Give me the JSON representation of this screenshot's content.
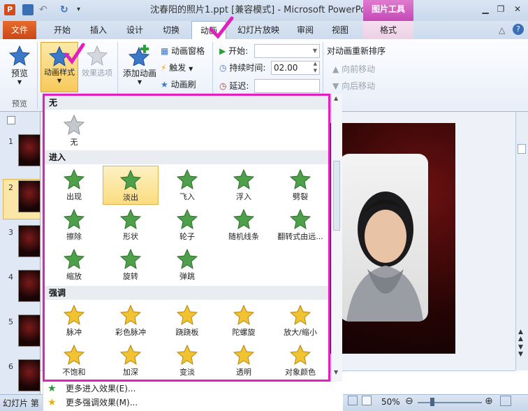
{
  "window": {
    "title": "沈春阳的照片1.ppt [兼容模式] - Microsoft PowerPoint",
    "context_tab_group": "图片工具",
    "app_icon": "P"
  },
  "tabs": [
    "文件",
    "开始",
    "插入",
    "设计",
    "切换",
    "动画",
    "幻灯片放映",
    "审阅",
    "视图",
    "格式"
  ],
  "active_tab": "动画",
  "ribbon": {
    "preview": {
      "label": "预览",
      "group": "预览"
    },
    "anim_styles": {
      "label": "动画样式"
    },
    "effect_options": {
      "label": "效果选项"
    },
    "add_animation": {
      "label": "添加动画"
    },
    "anim_pane": "动画窗格",
    "trigger": "触发",
    "anim_painter": "动画刷",
    "start_label": "开始:",
    "start_value": "",
    "duration_label": "持续时间:",
    "duration_value": "02.00",
    "delay_label": "延迟:",
    "delay_value": "",
    "reorder_title": "对动画重新排序",
    "move_earlier": "向前移动",
    "move_later": "向后移动"
  },
  "gallery": {
    "sections": [
      {
        "title": "无",
        "items": [
          {
            "label": "无",
            "icon": "star-gray-icon"
          }
        ]
      },
      {
        "title": "进入",
        "items": [
          {
            "label": "出现",
            "icon": "star-green-icon"
          },
          {
            "label": "淡出",
            "icon": "star-green-icon",
            "selected": true
          },
          {
            "label": "飞入",
            "icon": "star-green-icon"
          },
          {
            "label": "浮入",
            "icon": "star-green-icon"
          },
          {
            "label": "劈裂",
            "icon": "star-green-icon"
          },
          {
            "label": "擦除",
            "icon": "star-green-icon"
          },
          {
            "label": "形状",
            "icon": "star-green-icon"
          },
          {
            "label": "轮子",
            "icon": "star-green-icon"
          },
          {
            "label": "随机线条",
            "icon": "star-green-icon"
          },
          {
            "label": "翻转式由远...",
            "icon": "star-green-icon"
          },
          {
            "label": "缩放",
            "icon": "star-green-icon"
          },
          {
            "label": "旋转",
            "icon": "star-green-icon"
          },
          {
            "label": "弹跳",
            "icon": "star-green-icon"
          }
        ]
      },
      {
        "title": "强调",
        "items": [
          {
            "label": "脉冲",
            "icon": "star-gold-icon"
          },
          {
            "label": "彩色脉冲",
            "icon": "star-gold-icon"
          },
          {
            "label": "跷跷板",
            "icon": "star-gold-icon"
          },
          {
            "label": "陀螺旋",
            "icon": "star-gold-icon"
          },
          {
            "label": "放大/缩小",
            "icon": "star-gold-icon"
          },
          {
            "label": "不饱和",
            "icon": "star-gold-icon"
          },
          {
            "label": "加深",
            "icon": "star-gold-icon"
          },
          {
            "label": "变淡",
            "icon": "star-gold-icon"
          },
          {
            "label": "透明",
            "icon": "star-gold-icon"
          },
          {
            "label": "对象颜色",
            "icon": "star-gold-icon"
          }
        ]
      }
    ],
    "more": [
      "更多进入效果(E)...",
      "更多强调效果(M)..."
    ]
  },
  "slides": [
    "1",
    "2",
    "3",
    "4",
    "5",
    "6"
  ],
  "status": {
    "slide_label": "幻灯片 第",
    "zoom": "50%"
  },
  "colors": {
    "accent": "#e21fbf",
    "file_tab": "#d65a22",
    "selection": "#fbdc7f"
  }
}
